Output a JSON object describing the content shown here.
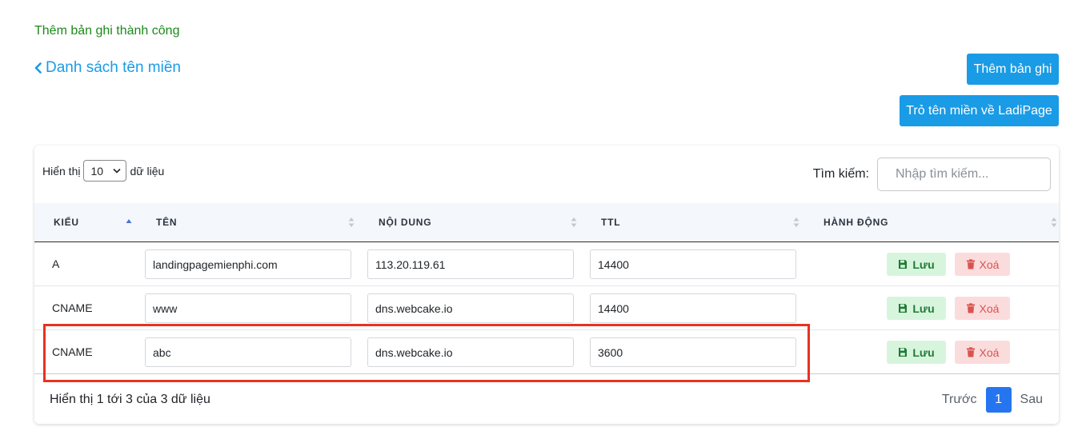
{
  "notice": "Thêm bản ghi thành công",
  "back_link": "Danh sách tên miền",
  "buttons": {
    "add_record": "Thêm bản ghi",
    "point_domain": "Trỏ tên miền về LadiPage"
  },
  "length": {
    "prefix": "Hiển thị",
    "value": "10",
    "suffix": "dữ liệu"
  },
  "search": {
    "label": "Tìm kiếm:",
    "placeholder": "Nhập tìm kiếm..."
  },
  "columns": [
    "KIỂU",
    "TÊN",
    "NỘI DUNG",
    "TTL",
    "HÀNH ĐỘNG"
  ],
  "rows": [
    {
      "type": "A",
      "name": "landingpagemienphi.com",
      "content": "113.20.119.61",
      "ttl": "14400"
    },
    {
      "type": "CNAME",
      "name": "www",
      "content": "dns.webcake.io",
      "ttl": "14400"
    },
    {
      "type": "CNAME",
      "name": "abc",
      "content": "dns.webcake.io",
      "ttl": "3600"
    }
  ],
  "actions": {
    "save": "Lưu",
    "delete": "Xoá"
  },
  "footer": {
    "info": "Hiển thị 1 tới 3 của 3 dữ liệu",
    "prev": "Trước",
    "page": "1",
    "next": "Sau"
  },
  "colors": {
    "primary": "#1a9be6",
    "success_text": "#1a8a1a",
    "highlight": "#e8321f",
    "page_active": "#2675f0"
  }
}
